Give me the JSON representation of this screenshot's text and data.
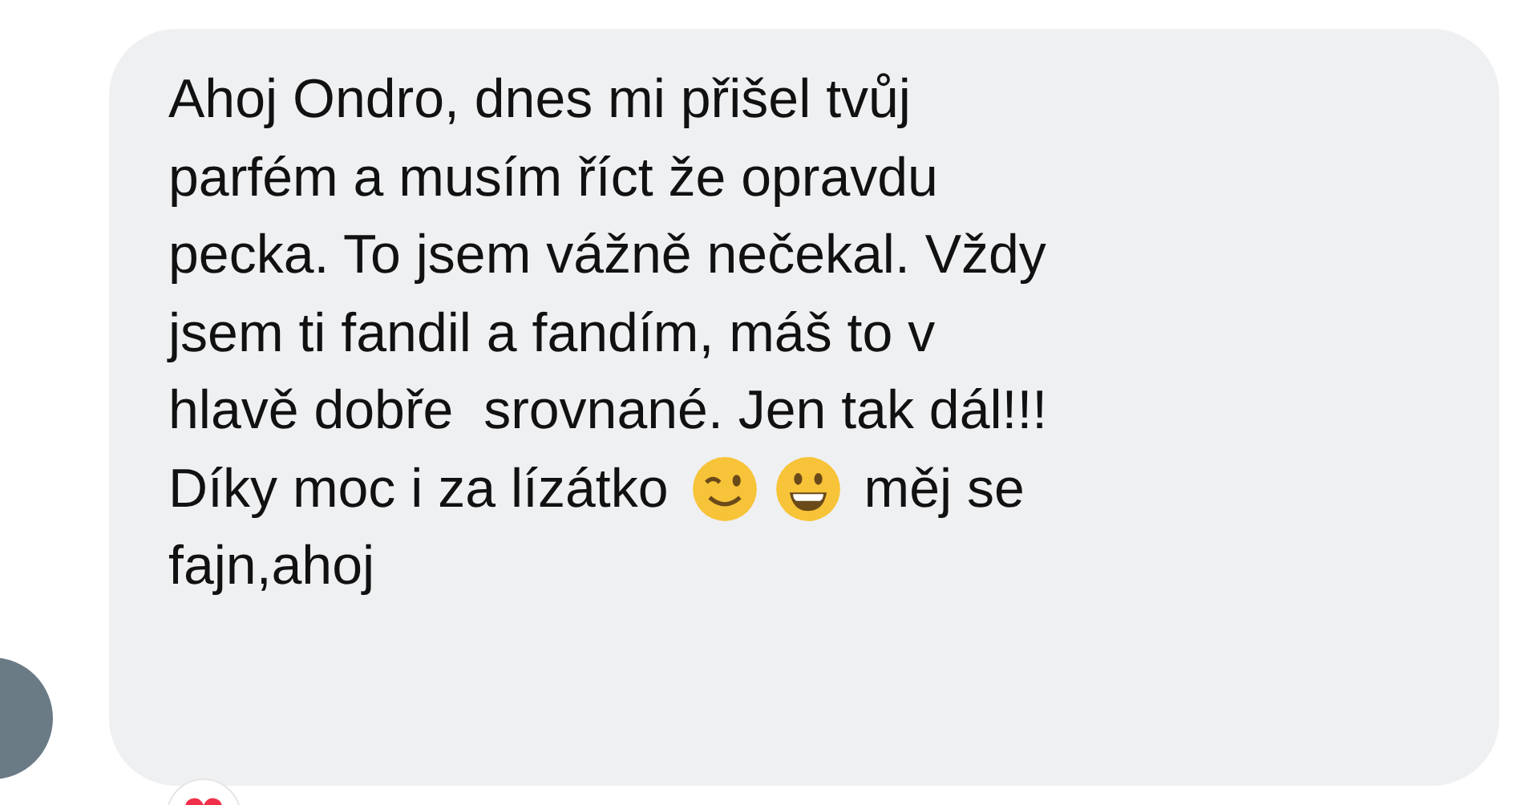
{
  "message": {
    "text": "Ahoj Ondro, dnes mi přišel tvůj\nparfém a musím říct že opravdu\npecka. To jsem vážně nečekal. Vždy\njsem ti fandil a fandím, máš to v\nhlavě dobře  srovnané. Jen tak dál!!!",
    "emoji_line_before": "Díky moc i za lízátko",
    "emoji_line_after": "měj se",
    "last_line": "fajn,ahoj",
    "reacted": true
  }
}
